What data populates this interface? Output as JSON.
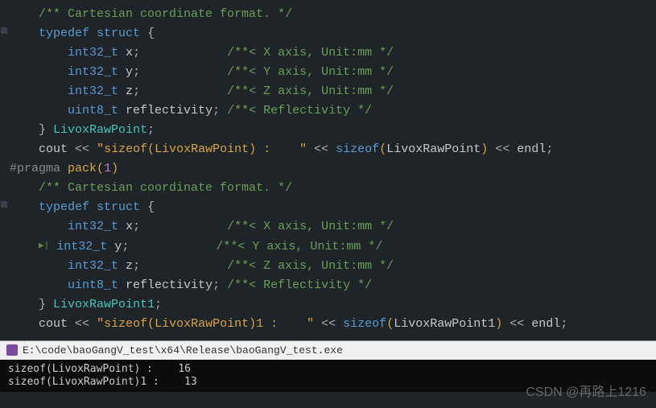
{
  "code": {
    "l1": "/** Cartesian coordinate format. */",
    "l2_typedef": "typedef",
    "l2_struct": "struct",
    "lbrace": "{",
    "int32": "int32_t",
    "uint8": "uint8_t",
    "fx": "x",
    "fy": "y",
    "fz": "z",
    "frefl": "reflectivity",
    "semi": ";",
    "cx": "/**< X axis, Unit:mm */",
    "cy": "/**< Y axis, Unit:mm */",
    "cz": "/**< Z axis, Unit:mm */",
    "crefl": "/**< Reflectivity */",
    "rbrace": "}",
    "name1": "LivoxRawPoint",
    "name2": "LivoxRawPoint1",
    "cout": "cout",
    "lshift": "<<",
    "str1": "\"sizeof(LivoxRawPoint) :    \"",
    "str2": "\"sizeof(LivoxRawPoint)1 :    \"",
    "sizeof": "sizeof",
    "lparen": "(",
    "rparen": ")",
    "endl": "endl",
    "pragma": "#pragma",
    "pack": "pack",
    "one": "1"
  },
  "console": {
    "path": "E:\\code\\baoGangV_test\\x64\\Release\\baoGangV_test.exe",
    "out1": "sizeof(LivoxRawPoint) :    16",
    "out2": "sizeof(LivoxRawPoint)1 :    13"
  },
  "watermark": "CSDN @再路上1216"
}
